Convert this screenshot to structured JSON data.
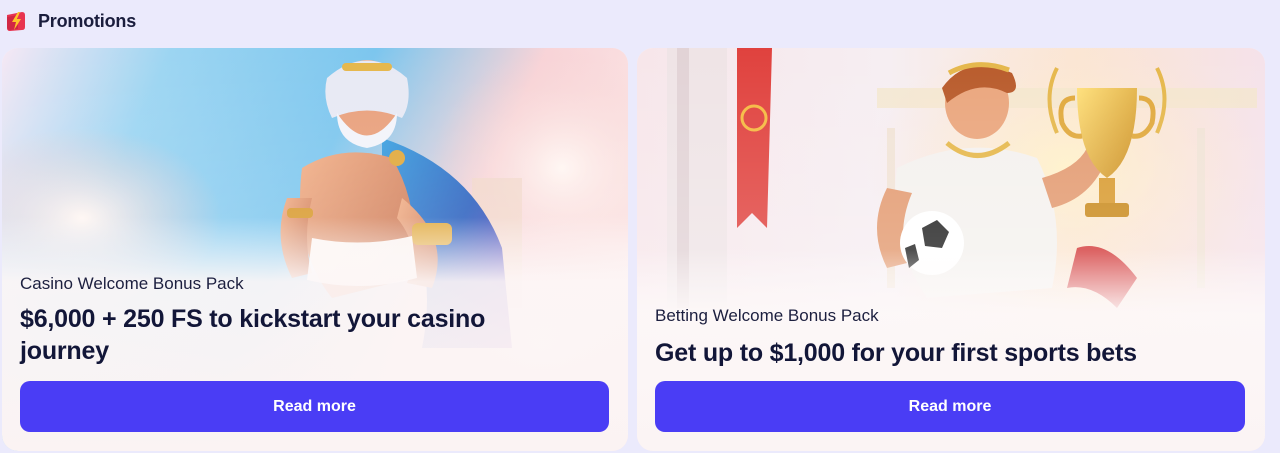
{
  "header": {
    "title": "Promotions",
    "icon": "lightning-bolt-icon",
    "icon_colors": {
      "badge": "#e8344f",
      "bolt": "#ffc42a"
    }
  },
  "promotions": [
    {
      "label": "Casino Welcome Bonus Pack",
      "headline": "$6,000 + 250 FS to kickstart your casino journey",
      "button_label": "Read more",
      "illustration": "zeus-illustration"
    },
    {
      "label": "Betting Welcome Bonus Pack",
      "headline": "Get up to $1,000 for your first sports bets",
      "button_label": "Read more",
      "illustration": "athlete-with-trophy-illustration"
    }
  ],
  "colors": {
    "page_background": "#ebeafc",
    "button": "#4a3df5",
    "headline_text": "#121638"
  }
}
